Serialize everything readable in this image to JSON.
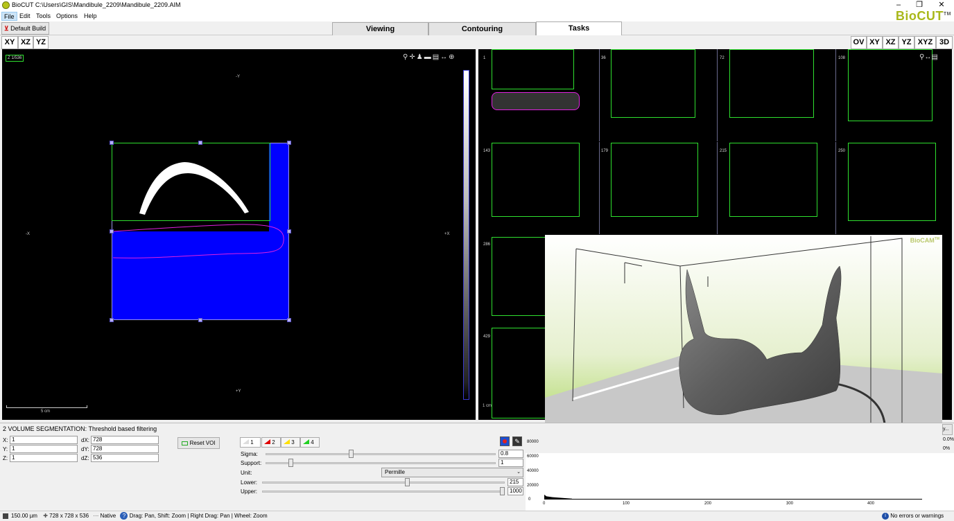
{
  "window": {
    "title": "BioCUT  C:\\Users\\GIS\\Mandibule_2209\\Mandibule_2209.AIM",
    "controls": [
      "–",
      "❐",
      "✕"
    ]
  },
  "menu": [
    "File",
    "Edit",
    "Tools",
    "Options",
    "Help"
  ],
  "brand": {
    "name": "BioCUT",
    "tm": "TM"
  },
  "toolbar": {
    "build_label": "Default Build"
  },
  "tabs": [
    "Viewing",
    "Contouring",
    "Tasks"
  ],
  "left_view": {
    "buttons": [
      "XY",
      "XZ",
      "YZ"
    ],
    "slice_label": "Z 1/536",
    "axes": {
      "top": "-Y",
      "bottom": "+Y",
      "left": "-X",
      "right": "+X"
    },
    "scale_label": "5 cm"
  },
  "right_view": {
    "buttons": [
      "OV",
      "XY",
      "XZ",
      "YZ",
      "XYZ",
      "3D"
    ],
    "slices": [
      "1",
      "36",
      "72",
      "108",
      "143",
      "179",
      "215",
      "250",
      "286",
      "429"
    ],
    "scale_label": "1 cm"
  },
  "overlay3d": {
    "brand": "BioCAM",
    "tm": "TM"
  },
  "segmentation": {
    "title": "2 VOLUME SEGMENTATION: Threshold based filtering",
    "coords": [
      {
        "label": "X:",
        "value": "1",
        "dlabel": "dX:",
        "dvalue": "728"
      },
      {
        "label": "Y:",
        "value": "1",
        "dlabel": "dY:",
        "dvalue": "728"
      },
      {
        "label": "Z:",
        "value": "1",
        "dlabel": "dZ:",
        "dvalue": "536"
      }
    ],
    "reset_label": "Reset VOI",
    "color_tabs": [
      "1",
      "2",
      "3",
      "4"
    ],
    "sigma": {
      "label": "Sigma:",
      "value": "0.8",
      "level": 0.37
    },
    "support": {
      "label": "Support:",
      "value": "1",
      "level": 0.1
    },
    "unit": {
      "label": "Unit:",
      "value": "Permille"
    },
    "lower": {
      "label": "Lower:",
      "value": "215",
      "level": 0.6
    },
    "upper": {
      "label": "Upper:",
      "value": "1000",
      "level": 1.0
    }
  },
  "histogram": {
    "y_ticks": [
      "80000",
      "60000",
      "40000",
      "20000",
      "0"
    ],
    "x_ticks": [
      "0",
      "100",
      "200",
      "300",
      "400"
    ],
    "right_labels": [
      "y...",
      "0.0%",
      "0%"
    ]
  },
  "colors": {
    "volume_blue": "#0000ff",
    "roi_green": "#2fe12f",
    "contour_magenta": "#e020e0",
    "brand": "#a9b81a"
  },
  "status": {
    "voxel": "150.00 µm",
    "dims": "728 x 728 x 536",
    "mode": "Native",
    "hint": "Drag: Pan, Shift: Zoom | Right Drag: Pan | Wheel: Zoom",
    "errors": "No errors or warnings"
  }
}
